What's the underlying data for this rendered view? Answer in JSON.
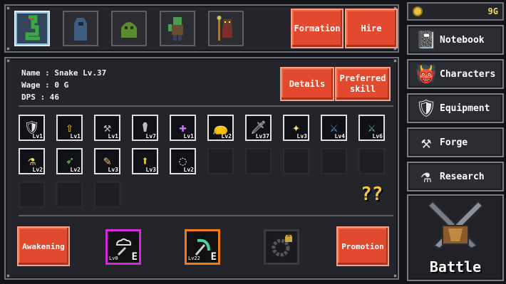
{
  "roster": [
    {
      "name": "snake",
      "selected": true
    },
    {
      "name": "hooded-ghost",
      "selected": false
    },
    {
      "name": "slime",
      "selected": false
    },
    {
      "name": "orc",
      "selected": false
    },
    {
      "name": "shaman",
      "selected": false
    }
  ],
  "top_buttons": {
    "formation": "Formation",
    "hire": "Hire"
  },
  "info": {
    "name": "Name : Snake Lv.37",
    "wage": "Wage : 0 G",
    "dps": "DPS : 46"
  },
  "detail_buttons": {
    "details": "Details",
    "preferred": "Preferred skill"
  },
  "skills": [
    {
      "icon": "shield-icon",
      "glyph": "🛡",
      "lv": "Lv1"
    },
    {
      "icon": "arrow-up-icon",
      "glyph": "⇧",
      "lv": "Lv1"
    },
    {
      "icon": "hammer-icon",
      "glyph": "⚒",
      "lv": "Lv1"
    },
    {
      "icon": "scythe-icon",
      "glyph": "⚰",
      "lv": "Lv7"
    },
    {
      "icon": "holy-cross-icon",
      "glyph": "✚",
      "lv": "Lv1"
    },
    {
      "icon": "pouch-icon",
      "glyph": "👝",
      "lv": "Lv2"
    },
    {
      "icon": "sword-icon",
      "glyph": "🗡",
      "lv": "Lv37"
    },
    {
      "icon": "stars-icon",
      "glyph": "✦",
      "lv": "Lv3"
    },
    {
      "icon": "blue-sword-icon",
      "glyph": "⚔",
      "lv": "Lv4"
    },
    {
      "icon": "green-sword-icon",
      "glyph": "⚔",
      "lv": "Lv6"
    },
    {
      "icon": "potion-icon",
      "glyph": "⚗",
      "lv": "Lv2"
    },
    {
      "icon": "green-arrow-icon",
      "glyph": "➶",
      "lv": "Lv2"
    },
    {
      "icon": "feather-icon",
      "glyph": "✎",
      "lv": "Lv3"
    },
    {
      "icon": "yellow-arrow-icon",
      "glyph": "⬆",
      "lv": "Lv3"
    },
    {
      "icon": "ring-icon",
      "glyph": "◌",
      "lv": "Lv2"
    }
  ],
  "locked_skills": [
    "figure-icon",
    "dark-shield-icon",
    "dark-frog-icon",
    "stairs-icon",
    "dark-drop-icon",
    "dark-cross-icon",
    "eye-icon",
    "claw-icon"
  ],
  "help_glyph": "??",
  "bottom": {
    "awakening": "Awakening",
    "promotion": "Promotion",
    "gem1": {
      "level": "Lv0",
      "equip": "E"
    },
    "gem2": {
      "level": "Lv22",
      "equip": "E"
    }
  },
  "gold": {
    "value": "9G"
  },
  "nav": [
    {
      "label": "Notebook",
      "icon": "notebook-icon",
      "glyph": "📓"
    },
    {
      "label": "Characters",
      "icon": "demon-mask-icon",
      "glyph": "👹"
    },
    {
      "label": "Equipment",
      "icon": "shield-equip-icon",
      "glyph": "🛡"
    },
    {
      "label": "Forge",
      "icon": "anvil-icon",
      "glyph": "⚒"
    },
    {
      "label": "Research",
      "icon": "flask-icon",
      "glyph": "⚗"
    }
  ],
  "battle": {
    "label": "Battle"
  }
}
